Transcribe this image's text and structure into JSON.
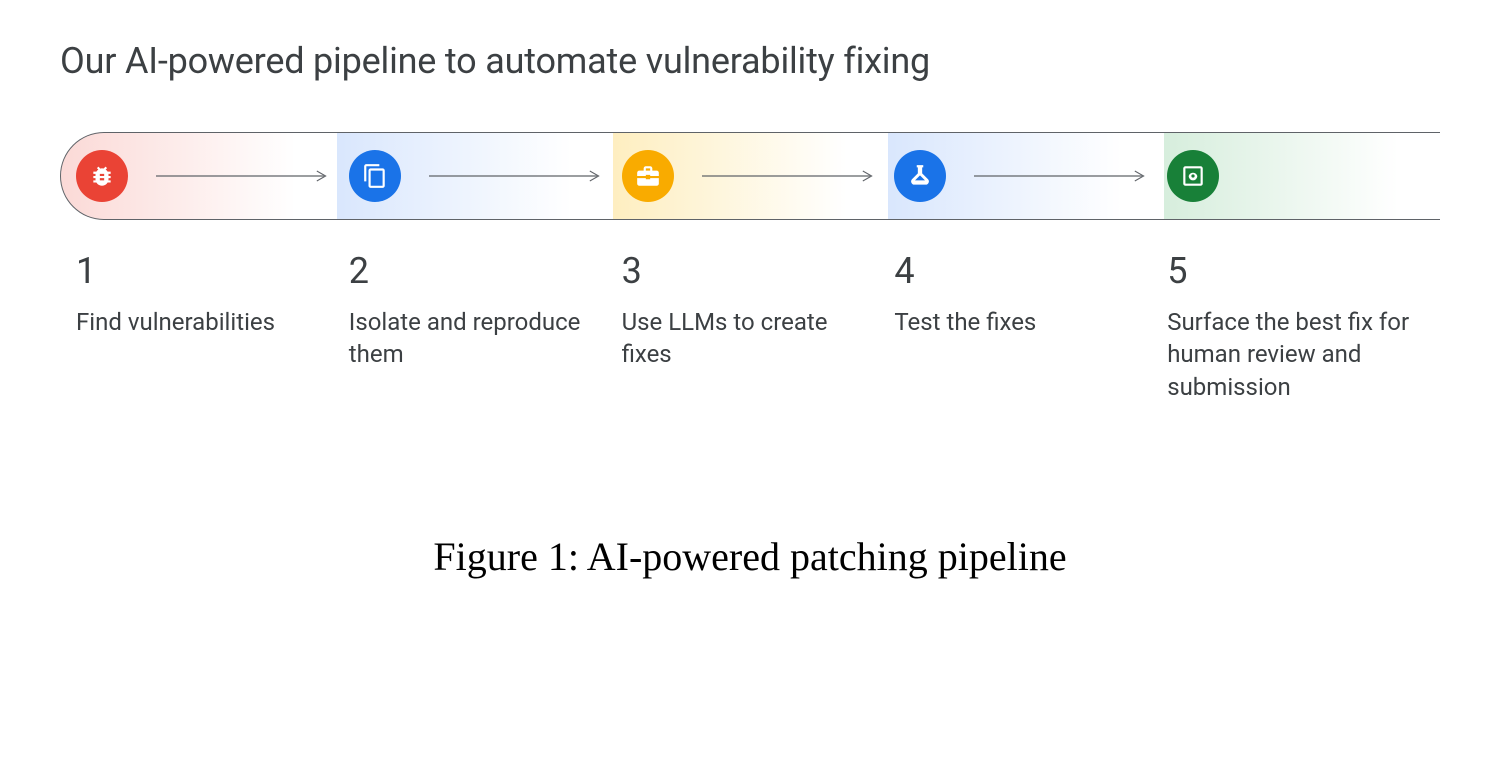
{
  "title": "Our AI-powered pipeline to automate vulnerability fixing",
  "caption": "Figure 1: AI-powered patching pipeline",
  "colors": {
    "red": "#ea4335",
    "blue": "#1a73e8",
    "yellow": "#f9ab00",
    "green": "#188038"
  },
  "steps": [
    {
      "num": "1",
      "desc": "Find vulnerabilities",
      "icon": "bug-icon",
      "circle_color": "#ea4335",
      "tint": "red"
    },
    {
      "num": "2",
      "desc": "Isolate and reproduce them",
      "icon": "copy-icon",
      "circle_color": "#1a73e8",
      "tint": "blue1"
    },
    {
      "num": "3",
      "desc": "Use LLMs to create fixes",
      "icon": "toolbox-icon",
      "circle_color": "#f9ab00",
      "tint": "yellow"
    },
    {
      "num": "4",
      "desc": "Test the fixes",
      "icon": "flask-icon",
      "circle_color": "#1a73e8",
      "tint": "blue2"
    },
    {
      "num": "5",
      "desc": "Surface the best fix for human review and submission",
      "icon": "preview-icon",
      "circle_color": "#188038",
      "tint": "green"
    }
  ]
}
